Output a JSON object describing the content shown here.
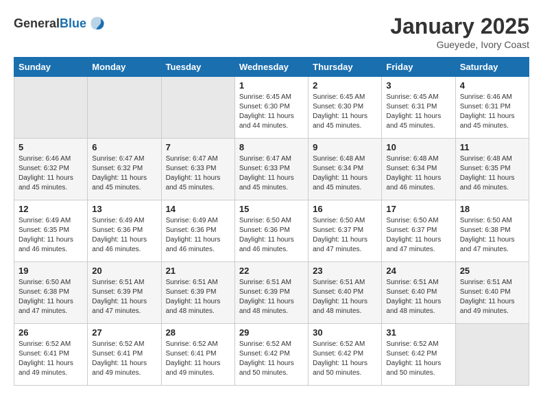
{
  "header": {
    "logo_general": "General",
    "logo_blue": "Blue",
    "month": "January 2025",
    "location": "Gueyede, Ivory Coast"
  },
  "weekdays": [
    "Sunday",
    "Monday",
    "Tuesday",
    "Wednesday",
    "Thursday",
    "Friday",
    "Saturday"
  ],
  "weeks": [
    [
      {
        "day": "",
        "empty": true
      },
      {
        "day": "",
        "empty": true
      },
      {
        "day": "",
        "empty": true
      },
      {
        "day": "1",
        "sunrise": "6:45 AM",
        "sunset": "6:30 PM",
        "daylight": "11 hours and 44 minutes."
      },
      {
        "day": "2",
        "sunrise": "6:45 AM",
        "sunset": "6:30 PM",
        "daylight": "11 hours and 45 minutes."
      },
      {
        "day": "3",
        "sunrise": "6:45 AM",
        "sunset": "6:31 PM",
        "daylight": "11 hours and 45 minutes."
      },
      {
        "day": "4",
        "sunrise": "6:46 AM",
        "sunset": "6:31 PM",
        "daylight": "11 hours and 45 minutes."
      }
    ],
    [
      {
        "day": "5",
        "sunrise": "6:46 AM",
        "sunset": "6:32 PM",
        "daylight": "11 hours and 45 minutes."
      },
      {
        "day": "6",
        "sunrise": "6:47 AM",
        "sunset": "6:32 PM",
        "daylight": "11 hours and 45 minutes."
      },
      {
        "day": "7",
        "sunrise": "6:47 AM",
        "sunset": "6:33 PM",
        "daylight": "11 hours and 45 minutes."
      },
      {
        "day": "8",
        "sunrise": "6:47 AM",
        "sunset": "6:33 PM",
        "daylight": "11 hours and 45 minutes."
      },
      {
        "day": "9",
        "sunrise": "6:48 AM",
        "sunset": "6:34 PM",
        "daylight": "11 hours and 45 minutes."
      },
      {
        "day": "10",
        "sunrise": "6:48 AM",
        "sunset": "6:34 PM",
        "daylight": "11 hours and 46 minutes."
      },
      {
        "day": "11",
        "sunrise": "6:48 AM",
        "sunset": "6:35 PM",
        "daylight": "11 hours and 46 minutes."
      }
    ],
    [
      {
        "day": "12",
        "sunrise": "6:49 AM",
        "sunset": "6:35 PM",
        "daylight": "11 hours and 46 minutes."
      },
      {
        "day": "13",
        "sunrise": "6:49 AM",
        "sunset": "6:36 PM",
        "daylight": "11 hours and 46 minutes."
      },
      {
        "day": "14",
        "sunrise": "6:49 AM",
        "sunset": "6:36 PM",
        "daylight": "11 hours and 46 minutes."
      },
      {
        "day": "15",
        "sunrise": "6:50 AM",
        "sunset": "6:36 PM",
        "daylight": "11 hours and 46 minutes."
      },
      {
        "day": "16",
        "sunrise": "6:50 AM",
        "sunset": "6:37 PM",
        "daylight": "11 hours and 47 minutes."
      },
      {
        "day": "17",
        "sunrise": "6:50 AM",
        "sunset": "6:37 PM",
        "daylight": "11 hours and 47 minutes."
      },
      {
        "day": "18",
        "sunrise": "6:50 AM",
        "sunset": "6:38 PM",
        "daylight": "11 hours and 47 minutes."
      }
    ],
    [
      {
        "day": "19",
        "sunrise": "6:50 AM",
        "sunset": "6:38 PM",
        "daylight": "11 hours and 47 minutes."
      },
      {
        "day": "20",
        "sunrise": "6:51 AM",
        "sunset": "6:39 PM",
        "daylight": "11 hours and 47 minutes."
      },
      {
        "day": "21",
        "sunrise": "6:51 AM",
        "sunset": "6:39 PM",
        "daylight": "11 hours and 48 minutes."
      },
      {
        "day": "22",
        "sunrise": "6:51 AM",
        "sunset": "6:39 PM",
        "daylight": "11 hours and 48 minutes."
      },
      {
        "day": "23",
        "sunrise": "6:51 AM",
        "sunset": "6:40 PM",
        "daylight": "11 hours and 48 minutes."
      },
      {
        "day": "24",
        "sunrise": "6:51 AM",
        "sunset": "6:40 PM",
        "daylight": "11 hours and 48 minutes."
      },
      {
        "day": "25",
        "sunrise": "6:51 AM",
        "sunset": "6:40 PM",
        "daylight": "11 hours and 49 minutes."
      }
    ],
    [
      {
        "day": "26",
        "sunrise": "6:52 AM",
        "sunset": "6:41 PM",
        "daylight": "11 hours and 49 minutes."
      },
      {
        "day": "27",
        "sunrise": "6:52 AM",
        "sunset": "6:41 PM",
        "daylight": "11 hours and 49 minutes."
      },
      {
        "day": "28",
        "sunrise": "6:52 AM",
        "sunset": "6:41 PM",
        "daylight": "11 hours and 49 minutes."
      },
      {
        "day": "29",
        "sunrise": "6:52 AM",
        "sunset": "6:42 PM",
        "daylight": "11 hours and 50 minutes."
      },
      {
        "day": "30",
        "sunrise": "6:52 AM",
        "sunset": "6:42 PM",
        "daylight": "11 hours and 50 minutes."
      },
      {
        "day": "31",
        "sunrise": "6:52 AM",
        "sunset": "6:42 PM",
        "daylight": "11 hours and 50 minutes."
      },
      {
        "day": "",
        "empty": true
      }
    ]
  ]
}
